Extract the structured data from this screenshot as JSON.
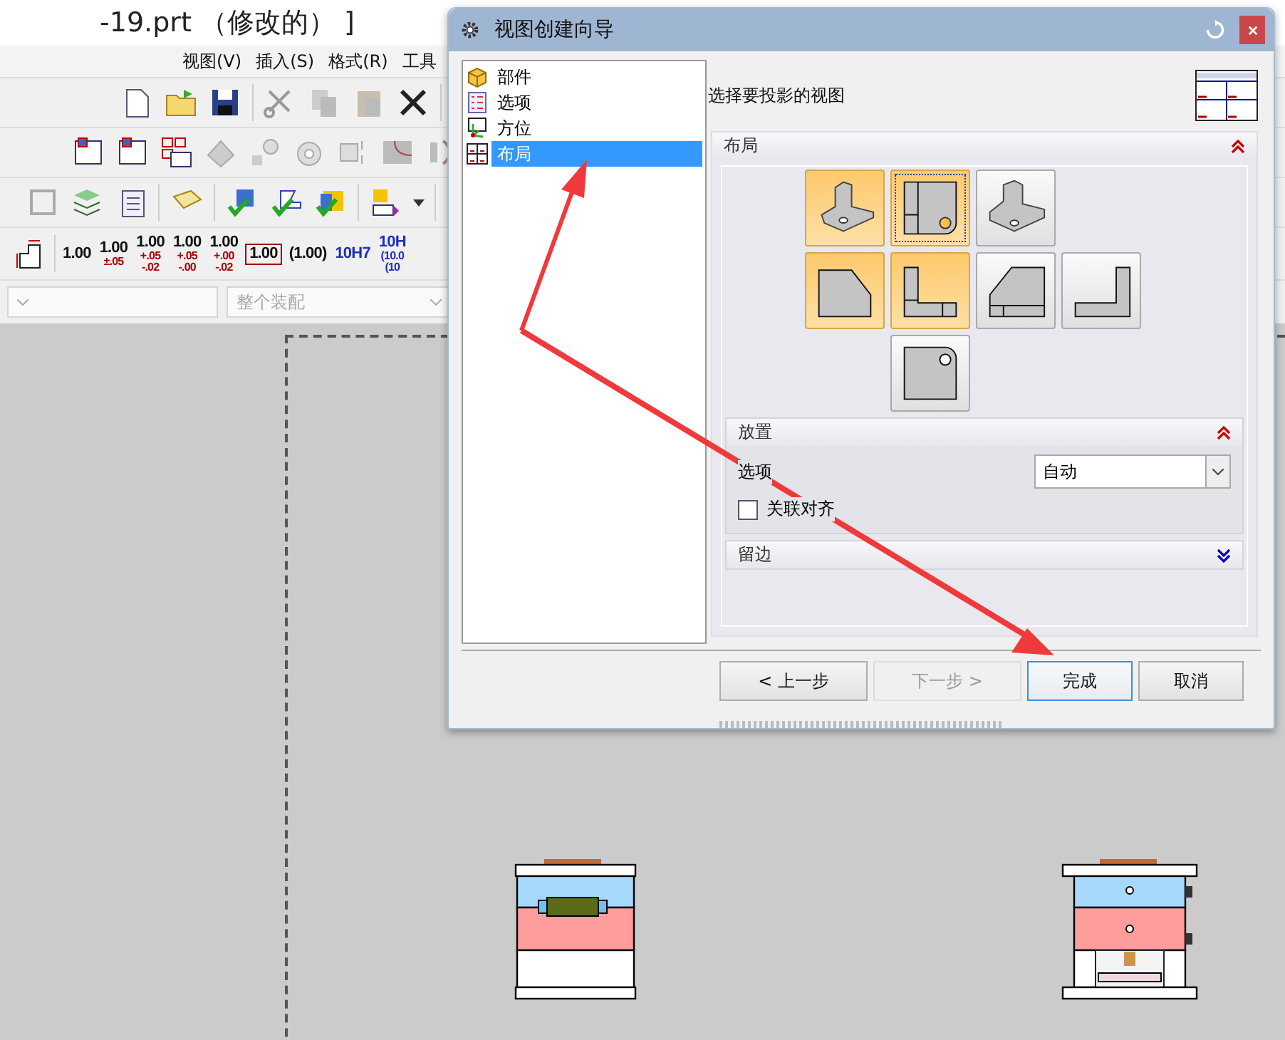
{
  "app": {
    "title": "-19.prt （修改的） ]",
    "menu": [
      "视图(V)",
      "插入(S)",
      "格式(R)",
      "工具"
    ],
    "dimension_styles": [
      {
        "kind": "plain",
        "main": "1.00"
      },
      {
        "kind": "symmetric",
        "main": "1.00",
        "tolerance": "±.05"
      },
      {
        "kind": "bilateral",
        "main": "1.00",
        "upper": "+.05",
        "lower": "-.02"
      },
      {
        "kind": "bilateral",
        "main": "1.00",
        "upper": "+.05",
        "lower": "-.00"
      },
      {
        "kind": "bilateral",
        "main": "1.00",
        "upper": "+.00",
        "lower": "-.02"
      },
      {
        "kind": "boxed",
        "main": "1.00"
      },
      {
        "kind": "reference",
        "main": "(1.00)"
      },
      {
        "kind": "fit",
        "main": "10H7"
      },
      {
        "kind": "fit-limits",
        "main": "10H",
        "upper": "(10.0",
        "lower": "(10"
      }
    ],
    "dropdowns": [
      {
        "disabled": true
      },
      {
        "value": "整个装配",
        "disabled": true
      }
    ]
  },
  "dialog": {
    "title": "视图创建向导",
    "steps": [
      {
        "label": "部件",
        "selected": false
      },
      {
        "label": "选项",
        "selected": false
      },
      {
        "label": "方位",
        "selected": false
      },
      {
        "label": "布局",
        "selected": true
      }
    ],
    "prompt": "选择要投影的视图",
    "layout": {
      "title": "布局",
      "expanded": true,
      "tiles": [
        {
          "kind": "trimetric",
          "selected": true,
          "focused": false
        },
        {
          "kind": "top",
          "selected": true,
          "focused": true
        },
        {
          "kind": "isometric",
          "selected": false,
          "focused": false
        },
        {
          "kind": "left",
          "selected": true,
          "focused": false
        },
        {
          "kind": "front",
          "selected": true,
          "focused": false
        },
        {
          "kind": "right",
          "selected": false,
          "focused": false
        },
        {
          "kind": "back",
          "selected": false,
          "focused": false
        },
        {
          "kind": "bottom",
          "selected": false,
          "focused": false
        }
      ]
    },
    "placement": {
      "title": "放置",
      "expanded": true,
      "option_label": "选项",
      "option_value": "自动",
      "checkbox": {
        "label": "关联对齐",
        "checked": false
      }
    },
    "margin": {
      "title": "留边",
      "expanded": false
    },
    "buttons": [
      {
        "label": "< 上一步",
        "disabled": false,
        "focused": false
      },
      {
        "label": "下一步 >",
        "disabled": true,
        "focused": false
      },
      {
        "label": "完成",
        "disabled": false,
        "focused": true
      },
      {
        "label": "取消",
        "disabled": false,
        "focused": false
      }
    ]
  }
}
